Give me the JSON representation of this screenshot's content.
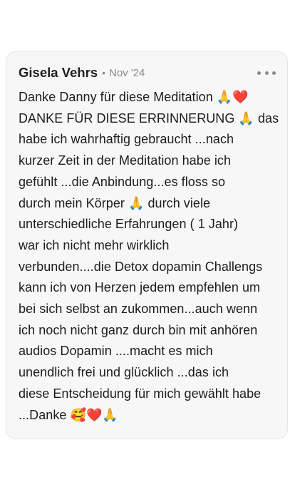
{
  "comment": {
    "author": "Gisela Vehrs",
    "separator": "•",
    "date": "Nov '24",
    "more_icon": "more-horizontal-icon",
    "text": "Danke Danny für diese Meditation 🙏❤️\nDANKE FÜR DIESE ERRINNERUNG 🙏 das\nhabe ich wahrhaftig gebraucht ...nach\nkurzer Zeit in der Meditation habe ich\ngefühlt ...die Anbindung...es floss so\ndurch mein Körper 🙏 durch viele\nunterschiedliche Erfahrungen ( 1 Jahr)\nwar ich nicht mehr wirklich\nverbunden....die Detox dopamin Challengs\nkann ich von Herzen jedem empfehlen um\nbei sich selbst an zukommen...auch wenn\nich noch nicht ganz durch bin mit anhören\naudios Dopamin ....macht es mich\nunendlich frei und glücklich ...das ich\ndiese Entscheidung für mich gewählt habe\n...Danke 🥰❤️🙏"
  },
  "colors": {
    "card_background": "#f7f7f7",
    "card_border": "#e6e6e6",
    "text": "#1c1c1c",
    "muted": "#8a8a8a"
  }
}
